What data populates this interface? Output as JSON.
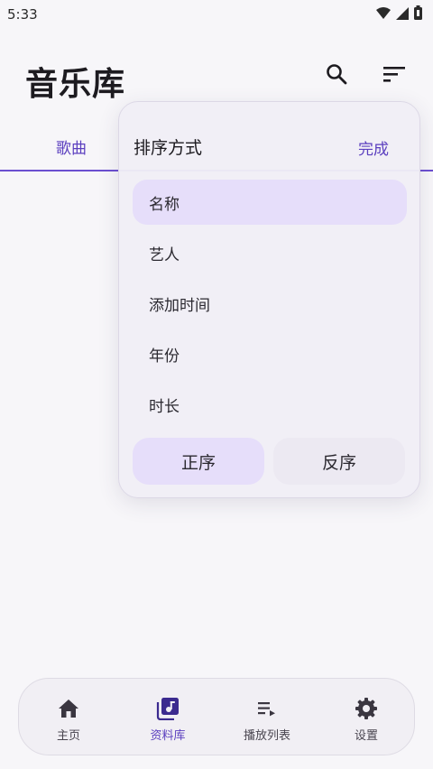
{
  "status_bar": {
    "time": "5:33",
    "icons": [
      "wifi-icon",
      "cellular-signal-icon",
      "battery-icon"
    ]
  },
  "header": {
    "title": "音乐库",
    "icons": [
      "search-icon",
      "sort-icon"
    ]
  },
  "tabs": {
    "active_label": "歌曲"
  },
  "sort_popup": {
    "title": "排序方式",
    "done_label": "完成",
    "options": [
      {
        "label": "名称",
        "selected": true
      },
      {
        "label": "艺人",
        "selected": false
      },
      {
        "label": "添加时间",
        "selected": false
      },
      {
        "label": "年份",
        "selected": false
      },
      {
        "label": "时长",
        "selected": false
      }
    ],
    "ascending_label": "正序",
    "descending_label": "反序",
    "order_selected": "正序"
  },
  "bottom_nav": {
    "items": [
      {
        "label": "主页",
        "icon": "home-icon",
        "active": false
      },
      {
        "label": "资料库",
        "icon": "library-music-icon",
        "active": true
      },
      {
        "label": "播放列表",
        "icon": "playlist-icon",
        "active": false
      },
      {
        "label": "设置",
        "icon": "gear-icon",
        "active": false
      }
    ]
  },
  "colors": {
    "accent": "#5b3fbf",
    "selected_background": "#e6defa",
    "popup_background": "#f0eef6",
    "page_background": "#f7f6f9"
  }
}
